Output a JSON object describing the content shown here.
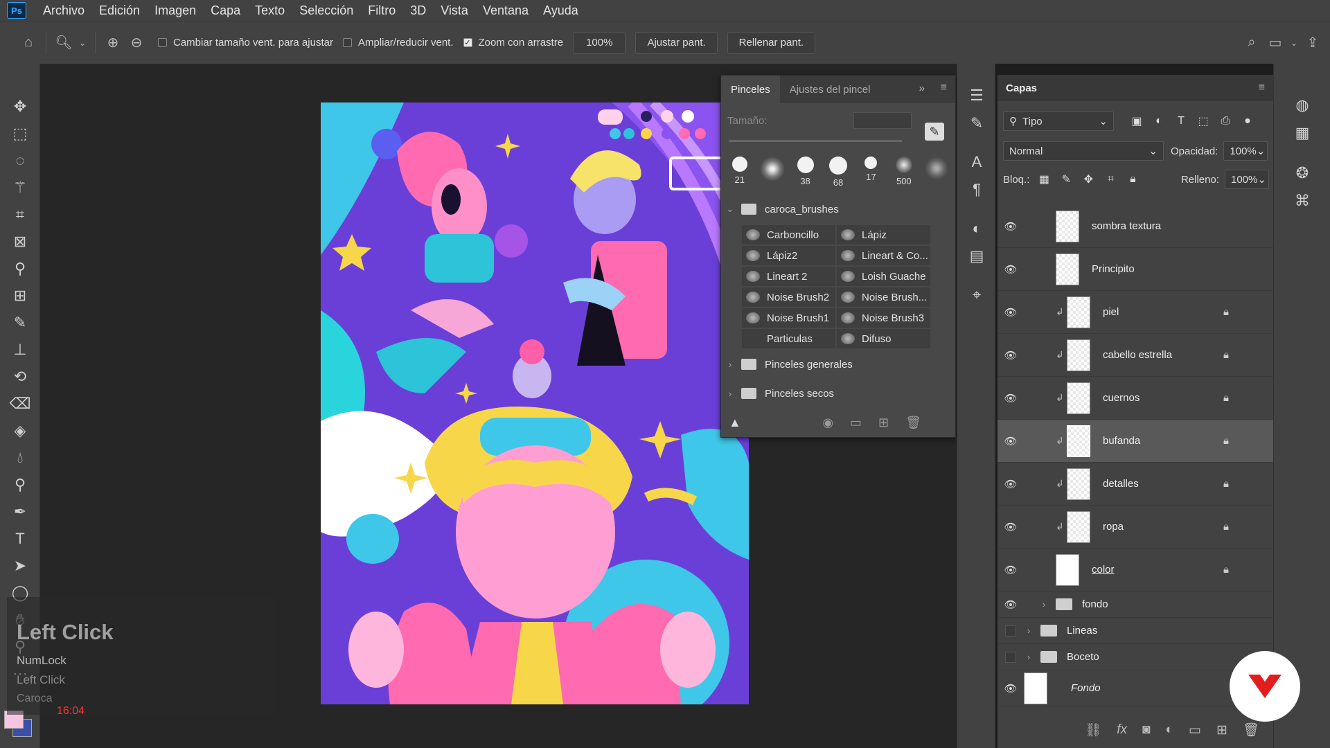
{
  "app": {
    "logo": "Ps"
  },
  "menu": [
    "Archivo",
    "Edición",
    "Imagen",
    "Capa",
    "Texto",
    "Selección",
    "Filtro",
    "3D",
    "Vista",
    "Ventana",
    "Ayuda"
  ],
  "options": {
    "resize_windows": "Cambiar tamaño vent. para ajustar",
    "zoom_all": "Ampliar/reducir vent.",
    "scrubby_zoom": "Zoom con arrastre",
    "zoom_value": "100%",
    "fit_screen": "Ajustar pant.",
    "fill_screen": "Rellenar pant."
  },
  "brushes_panel": {
    "tab_brushes": "Pinceles",
    "tab_settings": "Ajustes del pincel",
    "size_label": "Tamaño:",
    "presets": [
      "21",
      "",
      "38",
      "68",
      "17",
      "500",
      ""
    ],
    "folder_caroca": "caroca_brushes",
    "brushes": [
      [
        "Carboncillo",
        "Lápiz"
      ],
      [
        "Lápiz2",
        "Lineart & Co..."
      ],
      [
        "Lineart 2",
        "Loish Guache"
      ],
      [
        "Noise Brush2",
        "Noise Brush..."
      ],
      [
        "Noise Brush1",
        "Noise Brush3"
      ],
      [
        "Particulas",
        "Difuso"
      ]
    ],
    "folder_general": "Pinceles generales",
    "folder_dry": "Pinceles secos"
  },
  "layers_panel": {
    "title": "Capas",
    "filter": "Tipo",
    "blend_mode": "Normal",
    "opacity_label": "Opacidad:",
    "opacity_value": "100%",
    "lock_label": "Bloq.:",
    "fill_label": "Relleno:",
    "fill_value": "100%",
    "layers": [
      {
        "name": "sombra textura"
      },
      {
        "name": "Principito"
      },
      {
        "name": "piel"
      },
      {
        "name": "cabello estrella"
      },
      {
        "name": "cuernos"
      },
      {
        "name": "bufanda"
      },
      {
        "name": "detalles"
      },
      {
        "name": "ropa"
      },
      {
        "name": "color"
      },
      {
        "name": "fondo"
      },
      {
        "name": "Lineas"
      },
      {
        "name": "Boceto"
      },
      {
        "name": "Fondo"
      }
    ]
  },
  "overlay": {
    "title": "Left Click",
    "key": "NumLock",
    "sub": "Left Click",
    "author": "Caroca",
    "time": "16:04"
  },
  "colors": {
    "accent": "#31a8ff",
    "foreground": "#f6c6e0",
    "background": "#3a4fa5",
    "brand": "#e31d1d"
  }
}
